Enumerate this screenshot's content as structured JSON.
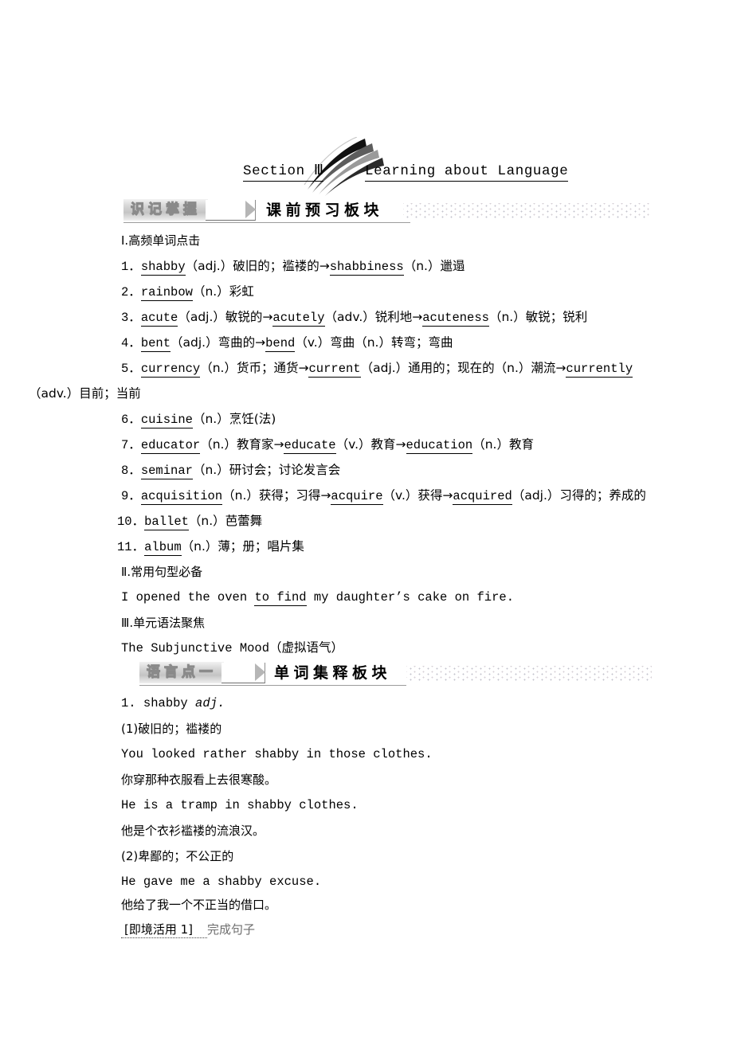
{
  "title": {
    "section_label": "Section Ⅲ",
    "section_name": "Learning about Language"
  },
  "banners": [
    {
      "tag": "识记掌握",
      "heading": "课前预习板块"
    },
    {
      "tag": "语言点一",
      "heading": "单词集释板块"
    }
  ],
  "preview": {
    "part1_heading": "Ⅰ.高频单词点击",
    "words": [
      {
        "num": "1．",
        "head": "shabby",
        "body": "（adj.）破旧的；褴褛的→",
        "derived": "shabbiness",
        "tail": "（n.）邋遢"
      },
      {
        "num": "2．",
        "head": "rainbow",
        "body": "（n.）彩虹",
        "derived": "",
        "tail": ""
      },
      {
        "num": "3．",
        "head": "acute",
        "body": "（adj.）敏锐的→",
        "derived": "acutely",
        "tail": "（adv.）锐利地→",
        "derived2": "acuteness",
        "tail2": "（n.）敏锐；锐利"
      },
      {
        "num": "4．",
        "head": "bent",
        "body": "（adj.）弯曲的→",
        "derived": "bend",
        "tail": "（v.）弯曲（n.）转弯；弯曲"
      },
      {
        "num": "5．",
        "head": "currency",
        "body": "（n.）货币；通货→",
        "derived": "current",
        "tail": "（adj.）通用的；现在的（n.）潮流→",
        "derived2": "currently",
        "wrap": "（adv.）目前；当前"
      },
      {
        "num": "6．",
        "head": "cuisine",
        "body": "（n.）烹饪(法)",
        "derived": "",
        "tail": ""
      },
      {
        "num": "7．",
        "head": "educator",
        "body": "（n.）教育家→",
        "derived": "educate",
        "tail": "（v.）教育→",
        "derived2": "education",
        "tail2": "（n.）教育"
      },
      {
        "num": "8．",
        "head": "seminar",
        "body": "（n.）研讨会；讨论发言会",
        "derived": "",
        "tail": ""
      },
      {
        "num": "9．",
        "head": "acquisition",
        "body": "（n.）获得；习得→",
        "derived": "acquire",
        "tail": "（v.）获得→",
        "derived2": "acquired",
        "tail2": "（adj.）习得的；养成的"
      },
      {
        "num": "10．",
        "head": "ballet",
        "body": "（n.）芭蕾舞",
        "derived": "",
        "tail": ""
      },
      {
        "num": "11．",
        "head": "album",
        "body": "（n.）薄；册；唱片集",
        "derived": "",
        "tail": ""
      }
    ],
    "part2_heading": "Ⅱ.常用句型必备",
    "sentence_pre": "I opened the oven ",
    "sentence_key": "to find",
    "sentence_post": " my daughter’s cake on fire.",
    "part3_heading": "Ⅲ.单元语法聚焦",
    "grammar_point": "The Subjunctive Mood（虚拟语气）"
  },
  "entry": {
    "num": "1.",
    "word": "shabby",
    "pos": "adj.",
    "sense1_label": "(1)破旧的；褴褛的",
    "sense1_ex1_en": "You looked rather shabby in those clothes.",
    "sense1_ex1_cn": "你穿那种衣服看上去很寒酸。",
    "sense1_ex2_en": "He is a tramp in shabby clothes.",
    "sense1_ex2_cn": "他是个衣衫褴褛的流浪汉。",
    "sense2_label": "(2)卑鄙的；不公正的",
    "sense2_ex1_en": "He gave me a shabby excuse.",
    "sense2_ex1_cn": "他给了我一个不正当的借口。",
    "exercise_label": "[即境活用 1]",
    "exercise_task": "完成句子"
  }
}
